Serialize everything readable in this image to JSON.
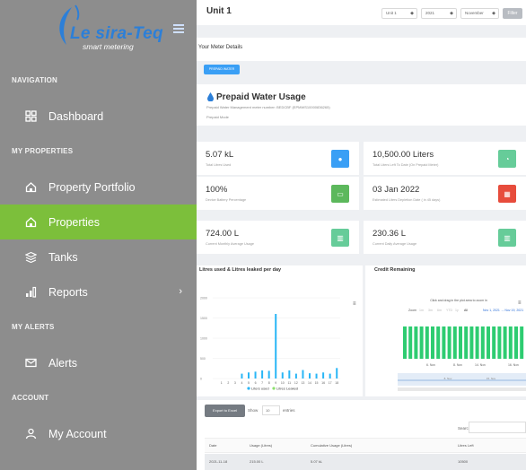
{
  "brand": {
    "name": "Le sira-Teq",
    "tagline": "smart metering"
  },
  "nav": {
    "sections": [
      {
        "header": "NAVIGATION",
        "items": [
          {
            "label": "Dashboard",
            "icon": "grid-icon"
          }
        ]
      },
      {
        "header": "MY PROPERTIES",
        "items": [
          {
            "label": "Property Portfolio",
            "icon": "home-icon"
          },
          {
            "label": "Properties",
            "icon": "home-icon",
            "active": true
          },
          {
            "label": "Tanks",
            "icon": "layers-icon"
          },
          {
            "label": "Reports",
            "icon": "bar-chart-icon",
            "chevron": "›"
          }
        ]
      },
      {
        "header": "MY ALERTS",
        "items": [
          {
            "label": "Alerts",
            "icon": "mail-icon"
          }
        ]
      },
      {
        "header": "ACCOUNT",
        "items": [
          {
            "label": "My Account",
            "icon": "user-icon"
          }
        ]
      }
    ]
  },
  "header": {
    "title": "Unit 1",
    "filters": {
      "unit": "Unit 1",
      "year": "2021",
      "month": "November"
    },
    "filter_label": "Filter"
  },
  "meter": {
    "title": "Your Meter Details",
    "prepaid_button": "PREPAID WATER"
  },
  "usage": {
    "title": "Prepaid Water Usage",
    "subtitle": "Prepaid Water Management meter number: BEDCBF (EPMWS10000836265)",
    "mode": "Prepaid Mode"
  },
  "cards": [
    {
      "value": "5.07 kL",
      "label": "Total Litres Used",
      "color": "#3a9ff5",
      "icon": "drop-icon"
    },
    {
      "value": "10,500.00 Liters",
      "label": "Total Liters Left To Date (On Prepaid Meter)",
      "color": "#66cc99",
      "icon": "gauge-icon"
    },
    {
      "value": "100%",
      "label": "Device Battery Percentage",
      "color": "#5cb85c",
      "icon": "battery-icon"
    },
    {
      "value": "03 Jan 2022",
      "label": "Estimated Liters Depletion Date ( in 45 days)",
      "color": "#e74c3c",
      "icon": "calendar-icon"
    },
    {
      "value": "724.00 L",
      "label": "Current Monthly Average Usage",
      "color": "#66cc99",
      "icon": "chart-icon"
    },
    {
      "value": "230.36 L",
      "label": "Current Daily Average Usage",
      "color": "#66cc99",
      "icon": "chart-icon"
    }
  ],
  "chart_left_title": "Litres used & Litres leaked per day",
  "chart_right_title": "Credit Remaining",
  "chart_right_hint": "Click and drag in the plot area to zoom in",
  "chart_right_zoom": {
    "label": "Zoom",
    "options": [
      "1m",
      "3m",
      "6m",
      "YTD",
      "1y",
      "All"
    ],
    "range": "Nov 1, 2021 → Nov 19, 2021"
  },
  "chart_right_xlabels": [
    "6. Nov",
    "8. Nov",
    "14. Nov",
    "16. Nov"
  ],
  "chart_right_nav_labels": [
    "8. Nov",
    "15. Nov"
  ],
  "chart_data": [
    {
      "type": "bar",
      "title": "Litres used & Litres leaked per day",
      "categories": [
        "1",
        "2",
        "3",
        "4",
        "5",
        "6",
        "7",
        "8",
        "9",
        "10",
        "11",
        "12",
        "13",
        "14",
        "15",
        "16",
        "17",
        "18"
      ],
      "series": [
        {
          "name": "Liters used",
          "values": [
            0,
            0,
            0,
            120,
            150,
            170,
            200,
            190,
            1600,
            150,
            200,
            120,
            210,
            130,
            120,
            150,
            120,
            260
          ]
        },
        {
          "name": "Litres Leaked",
          "values": [
            0,
            0,
            0,
            0,
            0,
            0,
            0,
            0,
            0,
            0,
            0,
            0,
            0,
            0,
            0,
            0,
            0,
            0
          ]
        }
      ],
      "yticks": [
        "2000",
        "1500",
        "1000",
        "500",
        "0"
      ],
      "ylim": [
        0,
        2000
      ],
      "legend": "bottom"
    },
    {
      "type": "bar",
      "title": "Credit Remaining",
      "values": [
        10,
        10,
        10,
        10,
        10,
        10,
        10,
        10,
        10,
        10,
        10,
        10,
        10,
        10,
        10,
        10,
        10,
        10,
        10,
        10,
        10,
        10
      ],
      "color": "#2ecc71"
    }
  ],
  "table": {
    "export_label": "Export to Excel",
    "show_label": "Show",
    "show_value": "10",
    "entries_label": "entries",
    "search_label": "Search:",
    "headers": [
      "Date",
      "Usage (Litres)",
      "Cumulative Usage (Litres)",
      "Litres Left"
    ],
    "rows": [
      [
        "2021-11-18",
        "215.00 L",
        "5.07 kL",
        "10500"
      ]
    ]
  }
}
